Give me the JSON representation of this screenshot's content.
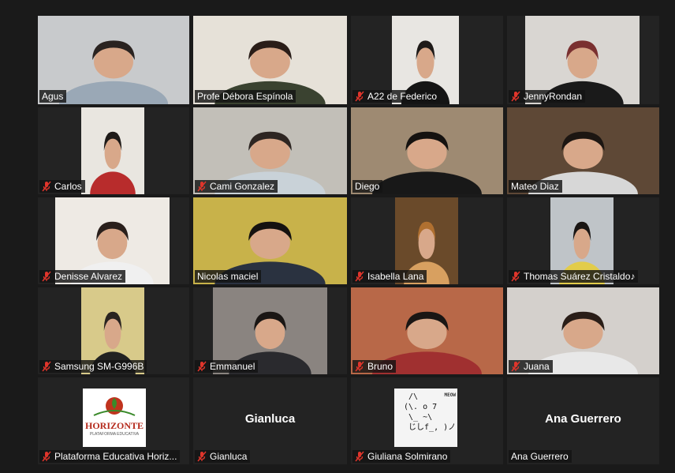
{
  "meeting": {
    "participants": [
      {
        "name": "Agus",
        "muted": false,
        "active": false,
        "video": true,
        "bg": "#c8cacc",
        "person": "#2a2320",
        "shirt": "#9aa8b6"
      },
      {
        "name": "Profe Débora Espínola",
        "muted": false,
        "active": true,
        "video": true,
        "bg": "#e6e1d8",
        "person": "#2a1d18",
        "shirt": "#3a4230"
      },
      {
        "name": "A22 de Federico",
        "muted": true,
        "active": false,
        "video": true,
        "bg": "#e8e6e2",
        "person": "#1e1a18",
        "shirt": "#151515"
      },
      {
        "name": "JennyRondan",
        "muted": true,
        "active": false,
        "video": true,
        "bg": "#d9d6d2",
        "person": "#7a3030",
        "shirt": "#1a1a1a"
      },
      {
        "name": "Carlos",
        "muted": true,
        "active": false,
        "video": true,
        "bg": "#e9e6e0",
        "person": "#1e1a18",
        "shirt": "#b82c2c"
      },
      {
        "name": "Cami Gonzalez",
        "muted": true,
        "active": false,
        "video": true,
        "bg": "#c2bfb8",
        "person": "#2e2622",
        "shirt": "#c9d2d8"
      },
      {
        "name": "Diego",
        "muted": false,
        "active": false,
        "video": true,
        "bg": "#9e8a72",
        "person": "#151210",
        "shirt": "#181818"
      },
      {
        "name": "Mateo Diaz",
        "muted": false,
        "active": false,
        "video": true,
        "bg": "#5e4836",
        "person": "#1c1612",
        "shirt": "#d7d7d7"
      },
      {
        "name": "Denisse Alvarez",
        "muted": true,
        "active": false,
        "video": true,
        "bg": "#eeeae4",
        "person": "#2a201c",
        "shirt": "#f0f0f0"
      },
      {
        "name": "Nicolas maciel",
        "muted": false,
        "active": false,
        "video": true,
        "bg": "#c8b24a",
        "person": "#151210",
        "shirt": "#2a3240"
      },
      {
        "name": "Isabella Lana",
        "muted": true,
        "active": false,
        "video": true,
        "bg": "#6a4a2a",
        "person": "#b07030",
        "shirt": "#d8a060"
      },
      {
        "name": "Thomas Suárez Cristaldo♪",
        "muted": true,
        "active": false,
        "video": true,
        "bg": "#bfc4c8",
        "person": "#1a1614",
        "shirt": "#e2cc4a"
      },
      {
        "name": "Samsung SM-G996B",
        "muted": true,
        "active": false,
        "video": true,
        "bg": "#d8ca8a",
        "person": "#2a2420",
        "shirt": "#222222"
      },
      {
        "name": "Emmanuel",
        "muted": true,
        "active": false,
        "video": true,
        "bg": "#8a8480",
        "person": "#1a1614",
        "shirt": "#2a2a2e"
      },
      {
        "name": "Bruno",
        "muted": true,
        "active": false,
        "video": true,
        "bg": "#b86848",
        "person": "#1a1614",
        "shirt": "#a03030"
      },
      {
        "name": "Juana",
        "muted": true,
        "active": false,
        "video": true,
        "bg": "#d4d0cc",
        "person": "#2a1e18",
        "shirt": "#e8e8e8"
      },
      {
        "name": "Plataforma Educativa Horiz...",
        "muted": true,
        "active": false,
        "video": false,
        "logo": true
      },
      {
        "name": "Gianluca",
        "muted": true,
        "active": false,
        "video": false,
        "display": "Gianluca"
      },
      {
        "name": "Giuliana Solmirano",
        "muted": true,
        "active": false,
        "video": false,
        "ascii": true
      },
      {
        "name": "Ana Guerrero",
        "muted": false,
        "active": false,
        "video": false,
        "display": "Ana Guerrero"
      }
    ],
    "logo": {
      "brand": "HORIZONTE",
      "tagline": "PLATAFORMA EDUCATIVA",
      "accent": "#c0331e",
      "leaf": "#3a8a2a"
    },
    "ascii": {
      "meow": "MEOW",
      "art": "  /\\\n (\\. o 7\n  \\_ ~\\\n  じしf_, )ノ"
    },
    "colors": {
      "mute_icon": "#e0352b",
      "active_border": "#c3d94a"
    }
  }
}
